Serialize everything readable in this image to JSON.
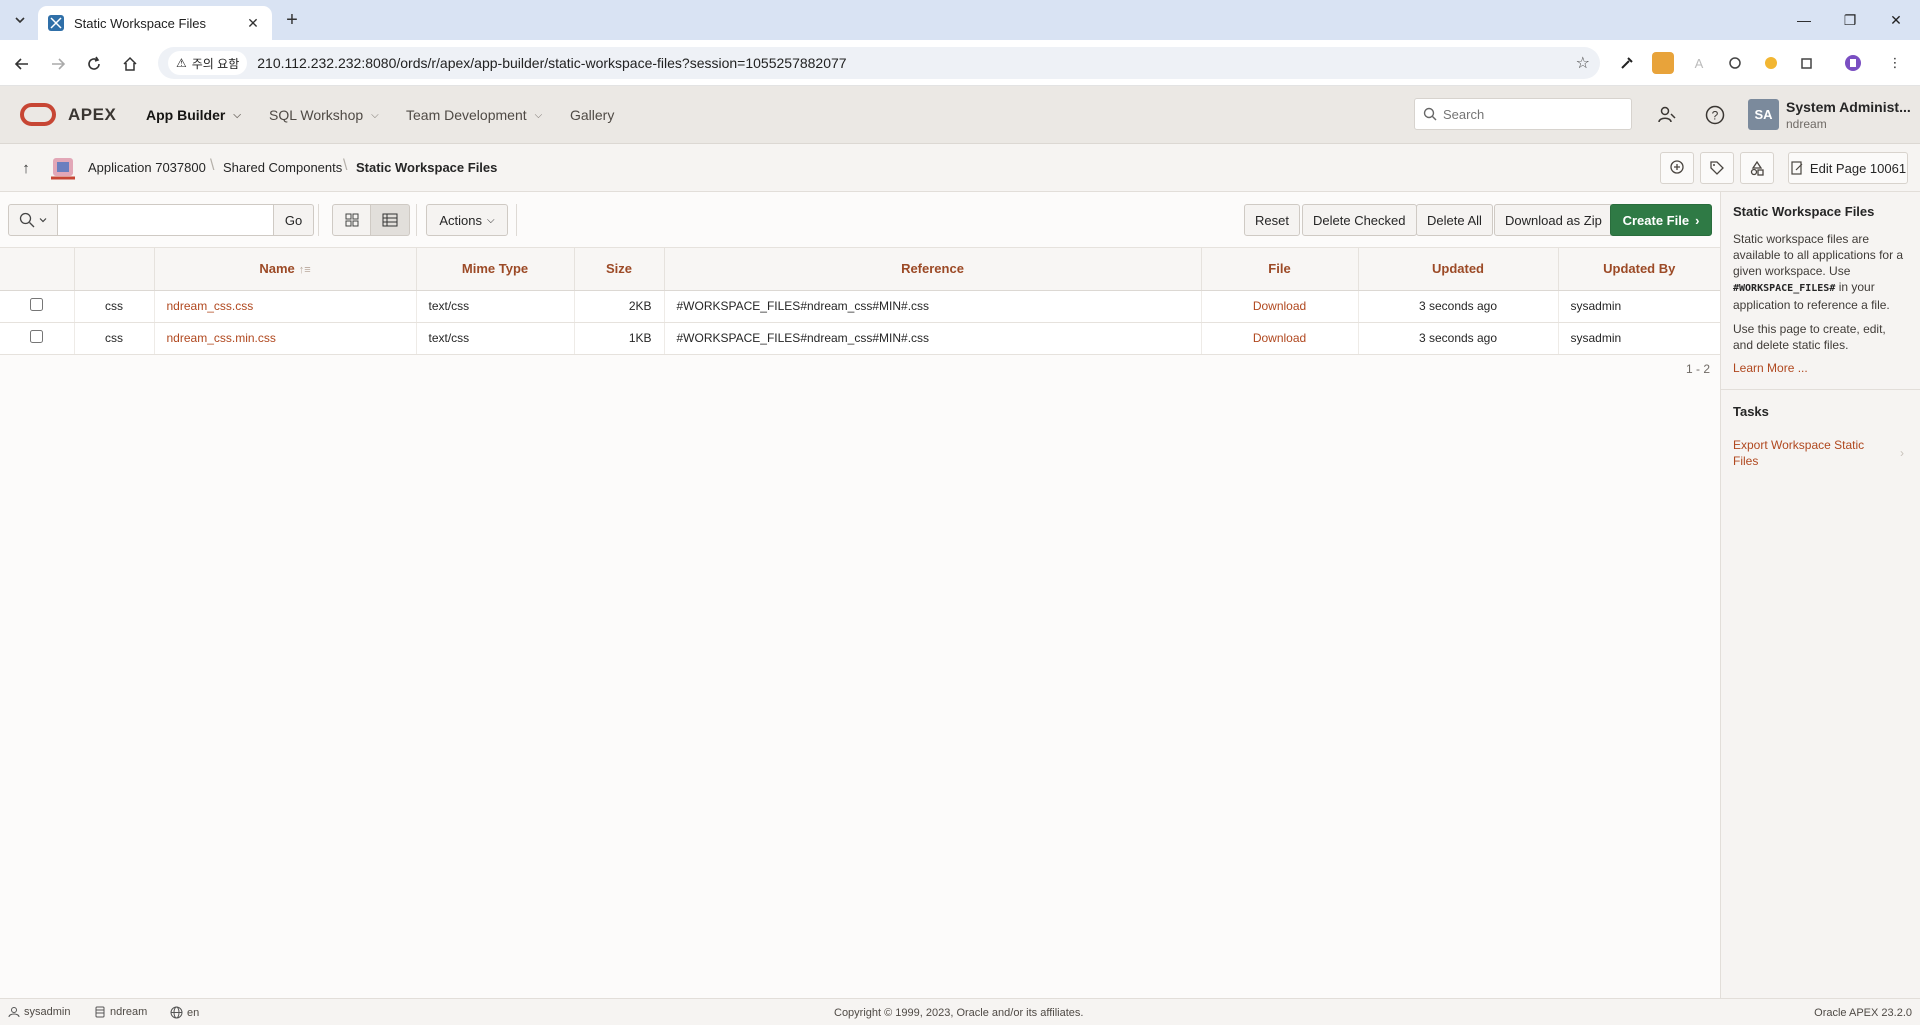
{
  "browser": {
    "tab_title": "Static Workspace Files",
    "security_label": "주의 요함",
    "url": "210.112.232.232:8080/ords/r/apex/app-builder/static-workspace-files?session=1055257882077"
  },
  "header": {
    "brand": "APEX",
    "nav": [
      "App Builder",
      "SQL Workshop",
      "Team Development",
      "Gallery"
    ],
    "search_placeholder": "Search",
    "avatar_initials": "SA",
    "user_name": "System Administ...",
    "workspace": "ndream"
  },
  "breadcrumb": {
    "items": [
      "Application 7037800",
      "Shared Components",
      "Static Workspace Files"
    ],
    "edit_page": "Edit Page 10061"
  },
  "toolbar": {
    "go": "Go",
    "actions": "Actions",
    "reset": "Reset",
    "delete_checked": "Delete Checked",
    "delete_all": "Delete All",
    "download_zip": "Download as Zip",
    "create_file": "Create File"
  },
  "report": {
    "columns": [
      "Name",
      "Mime Type",
      "Size",
      "Reference",
      "File",
      "Updated",
      "Updated By"
    ],
    "rows": [
      {
        "icon": "css",
        "name": "ndream_css.css",
        "mime": "text/css",
        "size": "2KB",
        "reference": "#WORKSPACE_FILES#ndream_css#MIN#.css",
        "file": "Download",
        "updated": "3 seconds ago",
        "updated_by": "sysadmin"
      },
      {
        "icon": "css",
        "name": "ndream_css.min.css",
        "mime": "text/css",
        "size": "1KB",
        "reference": "#WORKSPACE_FILES#ndream_css#MIN#.css",
        "file": "Download",
        "updated": "3 seconds ago",
        "updated_by": "sysadmin"
      }
    ],
    "pagination": "1 - 2"
  },
  "sidebar": {
    "title": "Static Workspace Files",
    "p1_before": "Static workspace files are available to all applications for a given workspace. Use ",
    "p1_code": "#WORKSPACE_FILES#",
    "p1_after": " in your application to reference a file.",
    "p2": "Use this page to create, edit, and delete static files.",
    "learn_more": "Learn More ...",
    "tasks_title": "Tasks",
    "tasks": [
      "Export Workspace Static Files"
    ]
  },
  "footer": {
    "user": "sysadmin",
    "workspace": "ndream",
    "language": "en",
    "copyright": "Copyright © 1999, 2023, Oracle and/or its affiliates.",
    "version": "Oracle APEX 23.2.0"
  },
  "colors": {
    "accent_link": "#b0481f",
    "create_button": "#2f7a45",
    "oracle_red": "#c74634"
  }
}
